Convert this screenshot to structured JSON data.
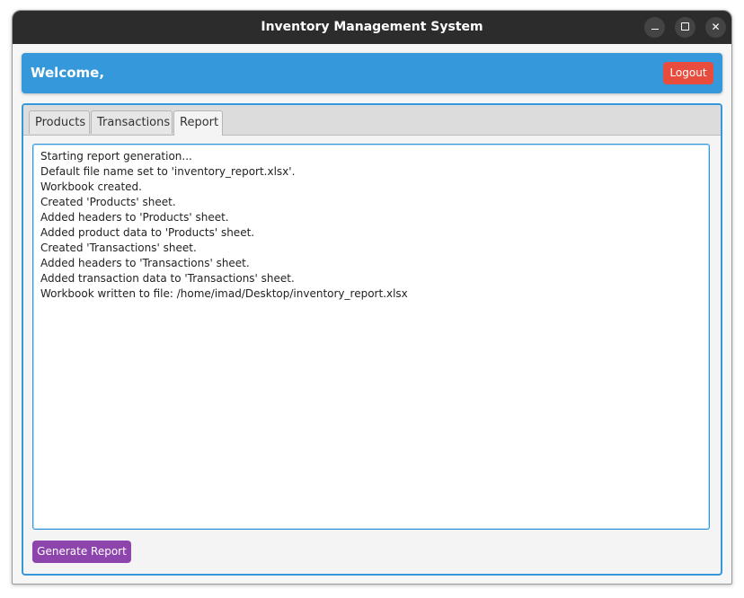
{
  "window": {
    "title": "Inventory Management System"
  },
  "header": {
    "welcome_text": "Welcome,",
    "logout_label": "Logout",
    "accent_color": "#3498db",
    "logout_color": "#e74c3c"
  },
  "tabs": [
    {
      "label": "Products",
      "selected": false
    },
    {
      "label": "Transactions",
      "selected": false
    },
    {
      "label": "Report",
      "selected": true
    }
  ],
  "report": {
    "log_lines": [
      "Starting report generation...",
      "Default file name set to 'inventory_report.xlsx'.",
      "Workbook created.",
      "Created 'Products' sheet.",
      "Added headers to 'Products' sheet.",
      "Added product data to 'Products' sheet.",
      "Created 'Transactions' sheet.",
      "Added headers to 'Transactions' sheet.",
      "Added transaction data to 'Transactions' sheet.",
      "Workbook written to file: /home/imad/Desktop/inventory_report.xlsx"
    ],
    "generate_label": "Generate Report",
    "generate_color": "#8e44ad"
  }
}
